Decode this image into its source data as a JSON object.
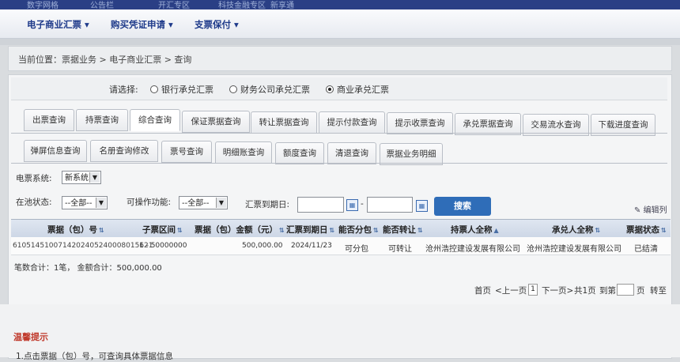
{
  "top_nav": [
    "数字网格",
    "公告栏",
    "开汇专区",
    "科技金融专区",
    "新享通"
  ],
  "menu": {
    "items": [
      {
        "label": "电子商业汇票",
        "caret": "▾"
      },
      {
        "label": "购买凭证申请",
        "caret": "▾"
      },
      {
        "label": "支票保付",
        "caret": "▾"
      }
    ]
  },
  "breadcrumb": "当前位置：票据业务 > 电子商业汇票 > 查询",
  "bill_type": {
    "label": "请选择:",
    "options": [
      "银行承兑汇票",
      "财务公司承兑汇票",
      "商业承兑汇票"
    ],
    "selected": "商业承兑汇票"
  },
  "tabs_row1": [
    "出票查询",
    "持票查询",
    "综合查询",
    "保证票据查询",
    "转让票据查询",
    "提示付款查询",
    "提示收票查询",
    "承兑票据查询",
    "交易流水查询",
    "下载进度查询"
  ],
  "tabs_row1_active": "综合查询",
  "tabs_row2": [
    "弹屏信息查询",
    "名册查询修改",
    "票号查询",
    "明细账查询",
    "额度查询",
    "清退查询",
    "票据业务明细"
  ],
  "filters": {
    "system_label": "电票系统:",
    "system_value": "新系统",
    "pool_label": "在池状态:",
    "pool_value": "--全部--",
    "op_label": "可操作功能:",
    "op_value": "--全部--",
    "due_label": "汇票到期日:",
    "date_sep": "-",
    "search_btn": "搜索",
    "edit_cols": "编辑列"
  },
  "table": {
    "columns": [
      "票据（包）号",
      "子票区间",
      "票据（包）金额（元）",
      "汇票到期日",
      "能否分包",
      "能否转让",
      "持票人全称",
      "承兑人全称",
      "票据状态"
    ],
    "rows": [
      [
        "6105145100714202405240008015621",
        "1 - 50000000",
        "500,000.00",
        "2024/11/23",
        "可分包",
        "可转让",
        "沧州浩控建设发展有限公司",
        "沧州浩控建设发展有限公司",
        "已结清"
      ]
    ]
  },
  "summary": "笔数合计：1笔，  金额合计：500,000.00",
  "pager": {
    "first": "首页",
    "prev": "<上一页",
    "page": "1",
    "next": "下一页>",
    "total": "共1页",
    "goto": "到第",
    "unit": "页",
    "go": "转至"
  },
  "tips": {
    "title": "温馨提示",
    "line1": "1.点击票据（包）号，可查询具体票据信息"
  }
}
